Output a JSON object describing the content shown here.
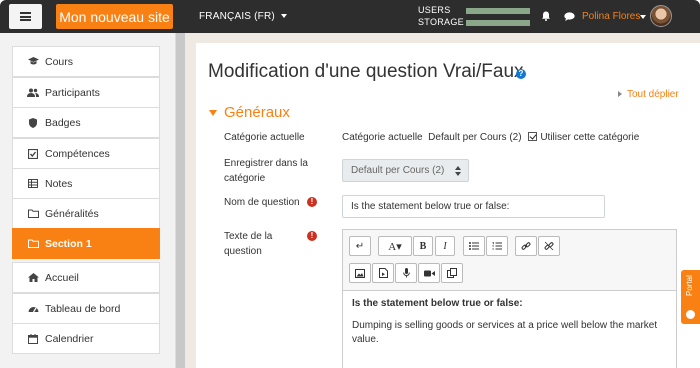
{
  "navbar": {
    "site_name": "Mon nouveau site",
    "language": "FRANÇAIS (FR)",
    "usage_users_label": "USERS",
    "usage_storage_label": "STORAGE",
    "usage_users_fraction": 1.0,
    "usage_storage_fraction": 1.0,
    "user_name": "Polina Flores",
    "icons": [
      "hamburger-icon",
      "bell-icon",
      "chat-icon",
      "user-avatar"
    ]
  },
  "drawer": {
    "items": [
      {
        "label": "Cours",
        "icon": "graduation-cap-icon"
      },
      {
        "label": "Participants",
        "icon": "users-icon"
      },
      {
        "label": "Badges",
        "icon": "shield-icon"
      },
      {
        "label": "Compétences",
        "icon": "check-square-icon"
      },
      {
        "label": "Notes",
        "icon": "table-icon"
      },
      {
        "label": "Généralités",
        "icon": "folder-icon"
      },
      {
        "label": "Section 1",
        "icon": "folder-icon",
        "active": true
      },
      {
        "label": "Accueil",
        "icon": "home-icon"
      },
      {
        "label": "Tableau de bord",
        "icon": "dashboard-icon"
      },
      {
        "label": "Calendrier",
        "icon": "calendar-icon"
      }
    ]
  },
  "page": {
    "title": "Modification d'une question Vrai/Faux",
    "expand_all": "Tout déplier",
    "section": "Généraux"
  },
  "form": {
    "current_category_label": "Catégorie actuelle",
    "current_category_prefix": "Catégorie actuelle",
    "current_category_value": "Default per Cours (2)",
    "use_category_label": "Utiliser cette catégorie",
    "save_in_label": "Enregistrer dans la catégorie",
    "save_in_value": "Default per Cours (2)",
    "question_name_label": "Nom de question",
    "question_name_value": "Is the statement below true or false:",
    "question_text_label": "Texte de la question"
  },
  "editor": {
    "toolbar_row1": [
      "↵",
      "A▾",
      "B",
      "I",
      "bullet-list",
      "numbered-list",
      "link",
      "unlink"
    ],
    "toolbar_row2": [
      "image",
      "media",
      "microphone",
      "video",
      "copy"
    ],
    "body_heading": "Is the statement below true or false:",
    "body_text": "Dumping is selling goods or services at a price well below the market value."
  },
  "portal_tab": "Portal",
  "colors": {
    "brand": "#f98012",
    "navbar": "#2d2d2d",
    "required": "#ca3120",
    "help": "#1177d1"
  }
}
